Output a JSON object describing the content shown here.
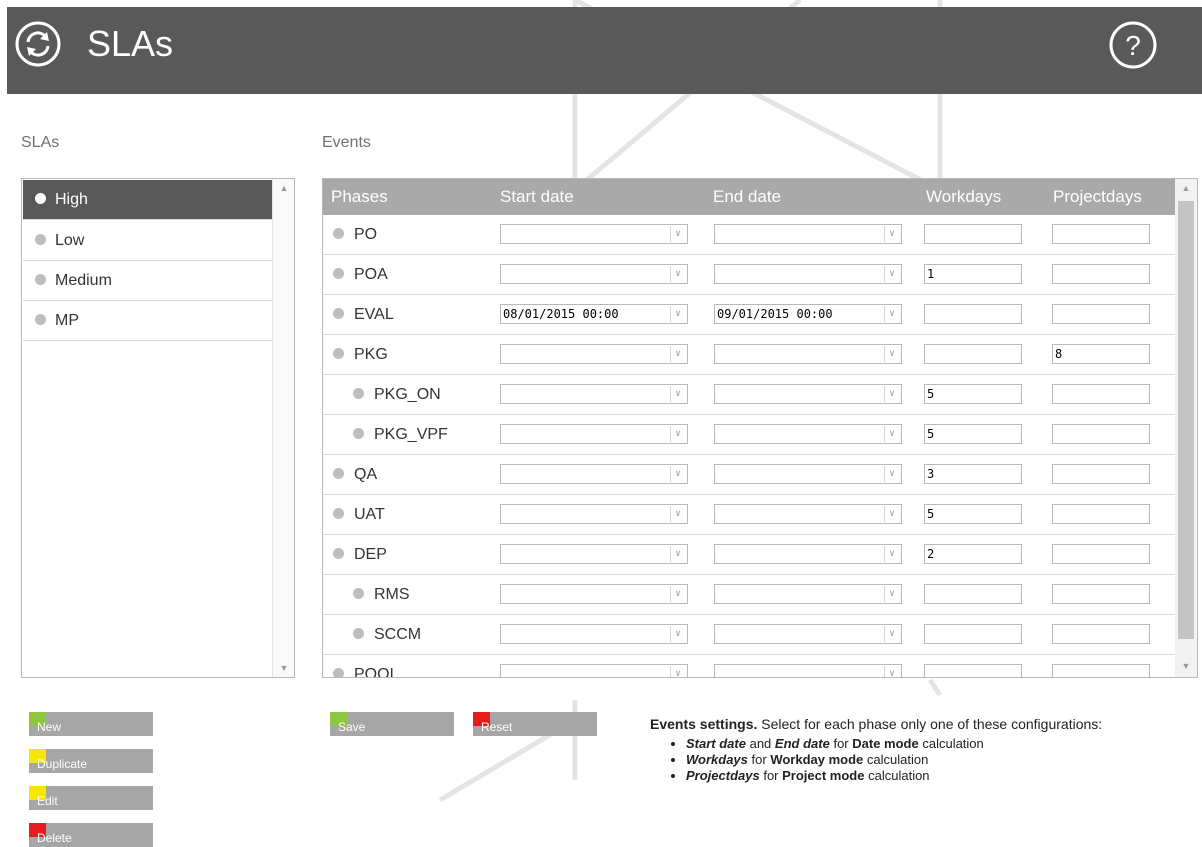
{
  "header": {
    "title": "SLAs"
  },
  "sla_panel": {
    "label": "SLAs",
    "items": [
      "High",
      "Low",
      "Medium",
      "MP"
    ],
    "selected": "High"
  },
  "events_panel": {
    "label": "Events",
    "columns": [
      "Phases",
      "Start date",
      "End date",
      "Workdays",
      "Projectdays"
    ],
    "rows": [
      {
        "phase": "PO",
        "start": "",
        "end": "",
        "workdays": "",
        "projectdays": ""
      },
      {
        "phase": "POA",
        "start": "",
        "end": "",
        "workdays": "1",
        "projectdays": ""
      },
      {
        "phase": "EVAL",
        "start": "08/01/2015 00:00",
        "end": "09/01/2015 00:00",
        "workdays": "",
        "projectdays": ""
      },
      {
        "phase": "PKG",
        "start": "",
        "end": "",
        "workdays": "",
        "projectdays": "8"
      },
      {
        "phase": "PKG_ON",
        "start": "",
        "end": "",
        "workdays": "5",
        "projectdays": ""
      },
      {
        "phase": "PKG_VPF",
        "start": "",
        "end": "",
        "workdays": "5",
        "projectdays": ""
      },
      {
        "phase": "QA",
        "start": "",
        "end": "",
        "workdays": "3",
        "projectdays": ""
      },
      {
        "phase": "UAT",
        "start": "",
        "end": "",
        "workdays": "5",
        "projectdays": ""
      },
      {
        "phase": "DEP",
        "start": "",
        "end": "",
        "workdays": "2",
        "projectdays": ""
      },
      {
        "phase": "RMS",
        "start": "",
        "end": "",
        "workdays": "",
        "projectdays": ""
      },
      {
        "phase": "SCCM",
        "start": "",
        "end": "",
        "workdays": "",
        "projectdays": ""
      },
      {
        "phase": "POOL",
        "start": "",
        "end": "",
        "workdays": "",
        "projectdays": ""
      }
    ]
  },
  "sla_buttons": {
    "new": "New",
    "duplicate": "Duplicate",
    "edit": "Edit",
    "delete": "Delete"
  },
  "event_buttons": {
    "save": "Save",
    "reset": "Reset"
  },
  "help": {
    "heading": "Events settings.",
    "intro": "Select for each phase only one of these configurations:",
    "items": [
      {
        "f1": "Start date",
        "and": "and",
        "f2": "End date",
        "for": "for",
        "mode": "Date mode",
        "suffix": "calculation"
      },
      {
        "f1": "Workdays",
        "for": "for",
        "mode": "Workday mode",
        "suffix": "calculation"
      },
      {
        "f1": "Projectdays",
        "for": "for",
        "mode": "Project mode",
        "suffix": "calculation"
      }
    ]
  },
  "colors": {
    "header": "#595959",
    "selected_item": "#595959",
    "table_header": "#a9a9a9",
    "button": "#a6a6a6",
    "new_mark": "#8dc63f",
    "duplicate_mark": "#f7e600",
    "edit_mark": "#f7e600",
    "delete_mark": "#e41e1e",
    "save_mark": "#8dc63f",
    "reset_mark": "#e41e1e"
  }
}
